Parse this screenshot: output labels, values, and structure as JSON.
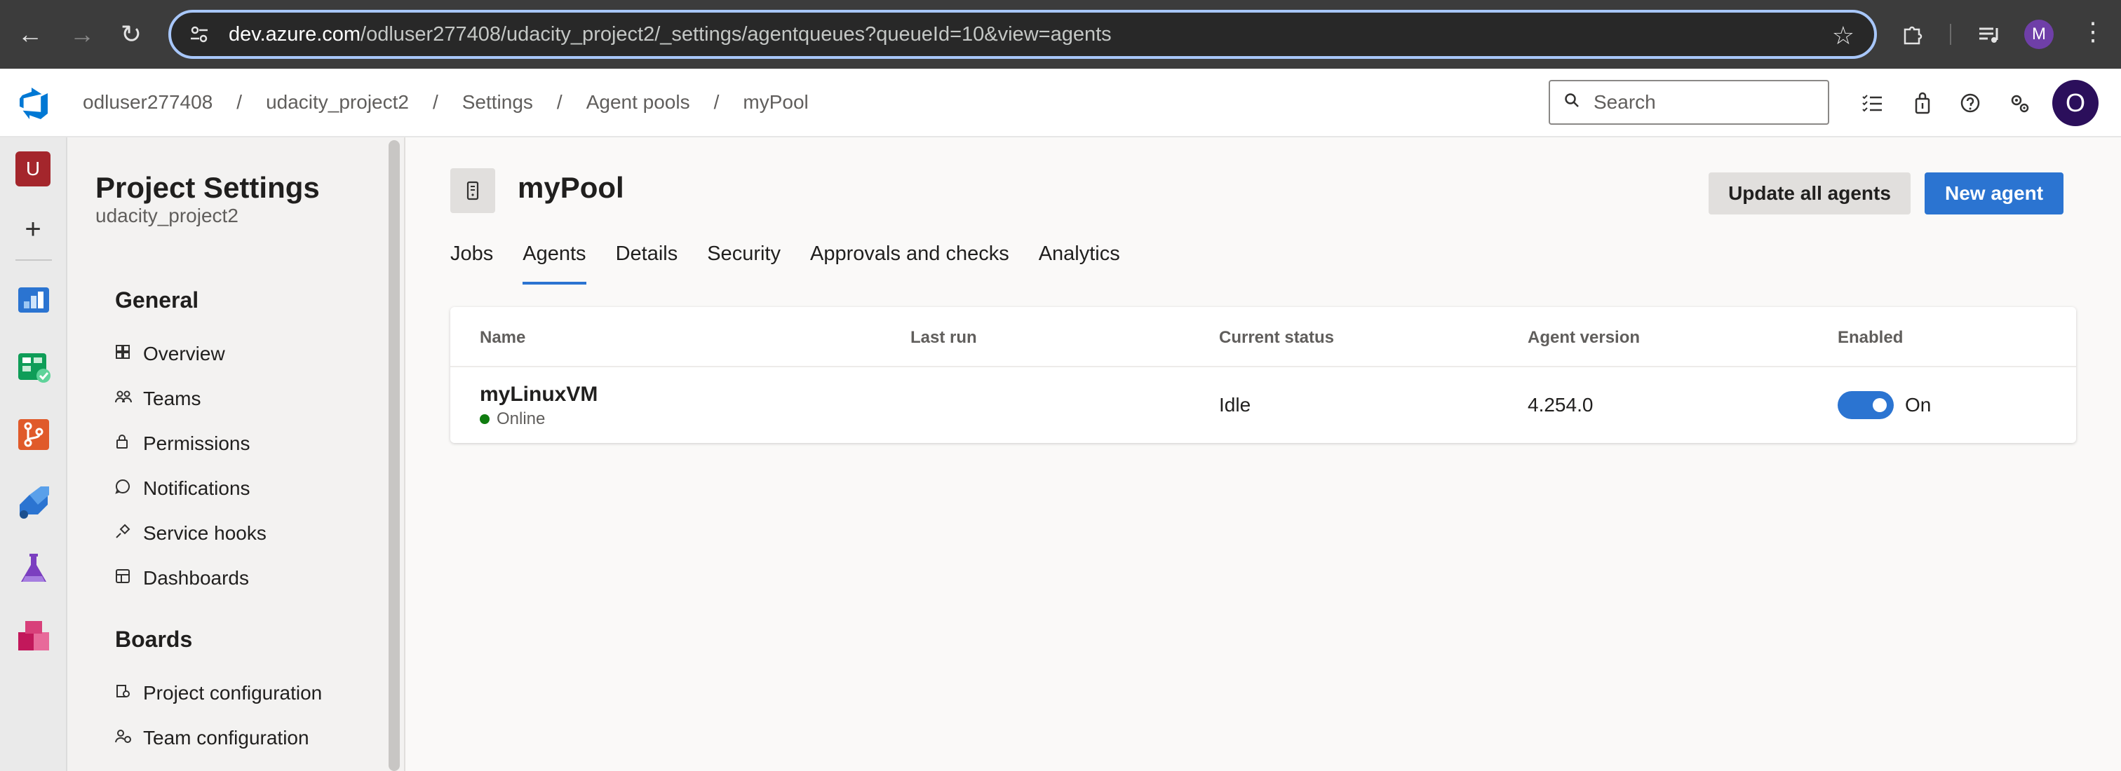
{
  "browser": {
    "url_host": "dev.azure.com",
    "url_path": "/odluser277408/udacity_project2/_settings/agentqueues?queueId=10&view=agents",
    "profile_initial": "M"
  },
  "header": {
    "breadcrumbs": [
      "odluser277408",
      "udacity_project2",
      "Settings",
      "Agent pools",
      "myPool"
    ],
    "breadcrumb_separator": "/",
    "search_placeholder": "Search",
    "user_initial": "O"
  },
  "leftnav": {
    "org_initial": "U",
    "services": [
      "overview",
      "boards",
      "repos",
      "pipelines",
      "test-plans",
      "artifacts"
    ]
  },
  "sidebar": {
    "title": "Project Settings",
    "subtitle": "udacity_project2",
    "groups": [
      {
        "heading": "General",
        "items": [
          {
            "label": "Overview",
            "icon": "overview-icon"
          },
          {
            "label": "Teams",
            "icon": "teams-icon"
          },
          {
            "label": "Permissions",
            "icon": "lock-icon"
          },
          {
            "label": "Notifications",
            "icon": "chat-icon"
          },
          {
            "label": "Service hooks",
            "icon": "plug-icon"
          },
          {
            "label": "Dashboards",
            "icon": "dashboard-icon"
          }
        ]
      },
      {
        "heading": "Boards",
        "items": [
          {
            "label": "Project configuration",
            "icon": "project-config-icon"
          },
          {
            "label": "Team configuration",
            "icon": "team-config-icon"
          }
        ]
      }
    ]
  },
  "main": {
    "pool_title": "myPool",
    "update_button": "Update all agents",
    "new_button": "New agent",
    "tabs": [
      "Jobs",
      "Agents",
      "Details",
      "Security",
      "Approvals and checks",
      "Analytics"
    ],
    "active_tab": "Agents",
    "table": {
      "columns": [
        "Name",
        "Last run",
        "Current status",
        "Agent version",
        "Enabled"
      ],
      "rows": [
        {
          "name": "myLinuxVM",
          "online": "Online",
          "last_run": "",
          "status": "Idle",
          "version": "4.254.0",
          "enabled_label": "On",
          "enabled": true
        }
      ]
    }
  },
  "colors": {
    "accent": "#2b74d1",
    "online": "#107c10",
    "org_badge": "#a4262c"
  }
}
